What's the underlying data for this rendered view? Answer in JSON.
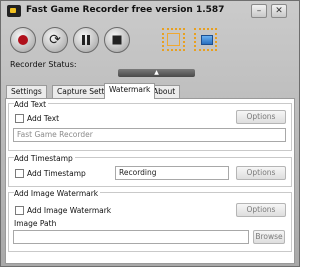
{
  "window": {
    "title": "Fast Game Recorder free version 1.587",
    "minimize_label": "–",
    "close_label": "✕"
  },
  "controls": {
    "record_icon": "record-icon",
    "refresh_icon": "refresh-icon",
    "pause_icon": "pause-icon",
    "stop_icon": "stop-icon",
    "capture_region_icon": "capture-region-icon",
    "capture_window_icon": "capture-window-icon",
    "collapse_label": "▲"
  },
  "status": {
    "label": "Recorder Status:"
  },
  "tabs": [
    {
      "label": "Settings",
      "active": false
    },
    {
      "label": "Capture Settings",
      "active": false
    },
    {
      "label": "Watermark",
      "active": true
    },
    {
      "label": "About",
      "active": false
    }
  ],
  "add_text": {
    "group_title": "Add Text",
    "checkbox_label": "Add Text",
    "checked": false,
    "options_label": "Options",
    "text_value": "Fast Game Recorder"
  },
  "add_timestamp": {
    "group_title": "Add Timestamp",
    "checkbox_label": "Add Timestamp",
    "checked": false,
    "value": "Recording",
    "options_label": "Options"
  },
  "add_image": {
    "group_title": "Add Image Watermark",
    "checkbox_label": "Add Image Watermark",
    "checked": false,
    "options_label": "Options",
    "path_label": "Image Path",
    "path_value": "",
    "browse_label": "Browse"
  },
  "colors": {
    "record": "#b0101b",
    "capture_accent": "#e8a020"
  }
}
